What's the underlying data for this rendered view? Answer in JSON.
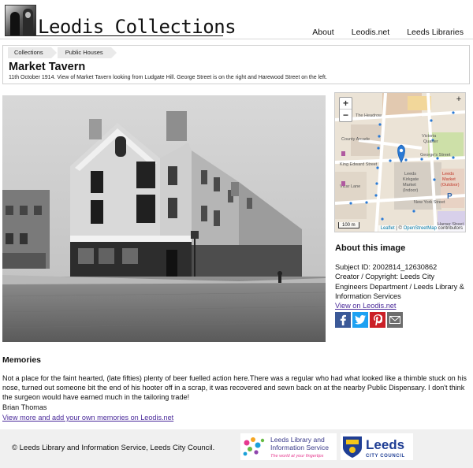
{
  "site": {
    "title": "Leodis Collections",
    "nav": [
      "About",
      "Leodis.net",
      "Leeds Libraries"
    ]
  },
  "breadcrumb": [
    "Collections",
    "Public Houses"
  ],
  "record": {
    "title": "Market Tavern",
    "caption": "11th October 1914. View of Market Tavern looking from Ludgate Hill. George Street is on the right and Harewood Street on the left."
  },
  "map": {
    "zoom_in": "+",
    "zoom_out": "−",
    "layers": "+",
    "scale": "100 m",
    "attribution_leaflet": "Leaflet",
    "attribution_sep": " | © ",
    "attribution_osm": "OpenStreetMap",
    "attribution_tail": " contributors",
    "labels": [
      "The Headrow",
      "Vicar Lane",
      "County Arcade",
      "King Edward Street",
      "George's Street",
      "Leeds Kirkgate Market (Indoor)",
      "Leeds Market (Outdoor)",
      "New York Street",
      "Kirkgate",
      "Victoria Quarter",
      "Harper Street",
      "P"
    ]
  },
  "about": {
    "heading": "About this image",
    "subject_id": "Subject ID: 2002814_12630862",
    "creator": "Creator / Copyright: Leeds City Engineers Department / Leeds Library & Information Services",
    "view_link": "View on Leodis.net",
    "share_icons": [
      "facebook-icon",
      "twitter-icon",
      "pinterest-icon",
      "email-icon"
    ]
  },
  "memories": {
    "heading": "Memories",
    "text": "Not a place for the faint hearted, (late fifties) plenty of beer fuelled action here.There was a regular who had what looked like a thimble stuck on his nose, turned out someone bit the end of his hooter off in a scrap, it was recovered and sewn back on at the nearby Public Dispensary. I don't think the surgeon would have earned much in the tailoring trade!",
    "author": "Brian Thomas",
    "more_link": "View more and add your own memories on Leodis.net"
  },
  "footer": {
    "text": "© Leeds Library and Information Service, Leeds City Council.",
    "lls_line1": "Leeds Library and",
    "lls_line2": "Information Service",
    "lls_tagline": "The world at your fingertips",
    "lcc_name": "Leeds",
    "lcc_sub": "CITY COUNCIL"
  },
  "colors": {
    "link": "#4a2a9a",
    "facebook": "#3b5998",
    "twitter": "#1da1f2",
    "pinterest": "#cb2027",
    "email": "#6d6d6d",
    "map_marker": "#2a7ad5",
    "lcc_blue": "#1f3e94"
  }
}
